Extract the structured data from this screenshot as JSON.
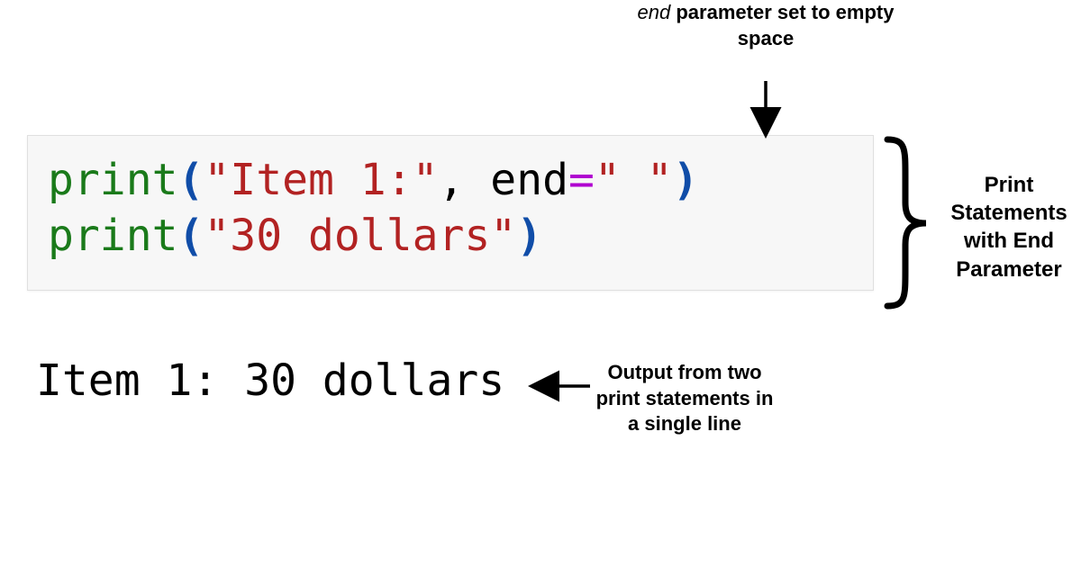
{
  "annotations": {
    "top": {
      "em": "end",
      "rest": " parameter set to empty space"
    },
    "right": "Print Statements with End Parameter",
    "bottom": "Output from two print statements in a single line"
  },
  "code": {
    "line1": {
      "fn": "print",
      "lparen": "(",
      "str1": "\"Item 1:\"",
      "comma_sp": ", ",
      "end_kw": "end",
      "eq": "=",
      "str2": "\" \"",
      "rparen": ")"
    },
    "line2": {
      "fn": "print",
      "lparen": "(",
      "str": "\"30 dollars\"",
      "rparen": ")"
    }
  },
  "output": "Item 1: 30 dollars"
}
